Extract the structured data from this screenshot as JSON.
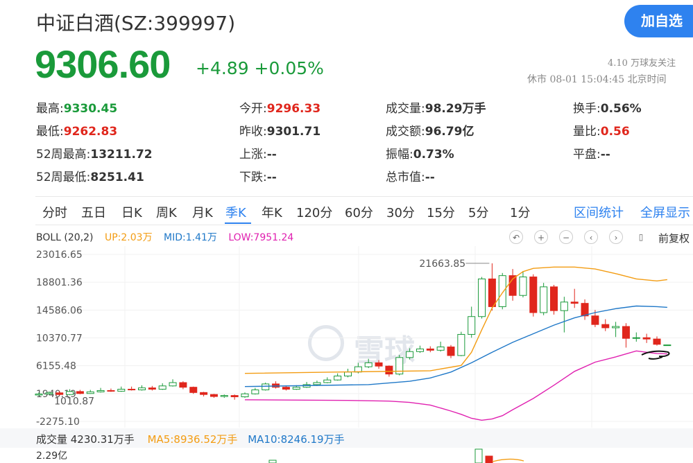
{
  "header": {
    "title": "中证白酒(SZ:399997)",
    "add_button": "加自选",
    "price": "9306.60",
    "change": "+4.89 +0.05%",
    "follow": "4.10 万球友关注",
    "status": "休市 08-01 15:04:45 北京时间"
  },
  "stats": [
    {
      "label": "最高:",
      "value": "9330.45",
      "tone": "down"
    },
    {
      "label": "今开:",
      "value": "9296.33",
      "tone": "up"
    },
    {
      "label": "成交量:",
      "value": "98.29万手",
      "tone": "neutral"
    },
    {
      "label": "换手:",
      "value": "0.56%",
      "tone": "neutral"
    },
    {
      "label": "最低:",
      "value": "9262.83",
      "tone": "up"
    },
    {
      "label": "昨收:",
      "value": "9301.71",
      "tone": "neutral"
    },
    {
      "label": "成交额:",
      "value": "96.79亿",
      "tone": "neutral"
    },
    {
      "label": "量比:",
      "value": "0.56",
      "tone": "up"
    },
    {
      "label": "52周最高:",
      "value": "13211.72",
      "tone": "neutral"
    },
    {
      "label": "上涨:",
      "value": "--",
      "tone": "neutral"
    },
    {
      "label": "振幅:",
      "value": "0.73%",
      "tone": "neutral"
    },
    {
      "label": "平盘:",
      "value": "--",
      "tone": "neutral"
    },
    {
      "label": "52周最低:",
      "value": "8251.41",
      "tone": "neutral"
    },
    {
      "label": "下跌:",
      "value": "--",
      "tone": "neutral"
    },
    {
      "label": "总市值:",
      "value": "--",
      "tone": "neutral"
    }
  ],
  "tabs": [
    "分时",
    "五日",
    "日K",
    "周K",
    "月K",
    "季K",
    "年K",
    "120分",
    "60分",
    "30分",
    "15分",
    "5分",
    "1分"
  ],
  "active_tab": "季K",
  "tab_actions": [
    "区间统计",
    "全屏显示"
  ],
  "indicator": {
    "name": "BOLL (20,2)",
    "up": "UP:2.03万",
    "mid": "MID:1.41万",
    "low": "LOW:7951.24",
    "up_color": "#f39c12",
    "mid_color": "#1f78c8",
    "low_color": "#e020b0"
  },
  "chart_controls": [
    "undo-icon",
    "zoom-in-icon",
    "zoom-out-icon",
    "scroll-left-icon",
    "scroll-right-icon",
    "candle-icon"
  ],
  "restore_label": "前复权",
  "watermark": "雪球",
  "volume": {
    "label": "成交量 4230.31万手",
    "ma5": "MA5:8936.52万手",
    "ma10": "MA10:8246.19万手",
    "max_label": "2.29亿",
    "ma5_color": "#f39c12",
    "ma10_color": "#1f78c8"
  },
  "colors": {
    "rise": "#e0261c",
    "fall": "#1a9a3a",
    "accent": "#2e82ef"
  },
  "chart_data": {
    "type": "candlestick",
    "y_ticks": [
      "23016.65",
      "18801.36",
      "14586.06",
      "10370.77",
      "6155.48",
      "1940.19",
      "-2275.10"
    ],
    "ylim": [
      -2275.1,
      23016.65
    ],
    "high_annotation": "21663.85",
    "low_annotation": "1010.87",
    "candles": [
      {
        "o": 1720,
        "c": 1880,
        "h": 2100,
        "l": 1600
      },
      {
        "o": 1880,
        "c": 2050,
        "h": 2300,
        "l": 1800
      },
      {
        "o": 2050,
        "c": 1800,
        "h": 2300,
        "l": 1700
      },
      {
        "o": 1800,
        "c": 2250,
        "h": 2600,
        "l": 1700
      },
      {
        "o": 2250,
        "c": 1950,
        "h": 2500,
        "l": 1850
      },
      {
        "o": 1950,
        "c": 2200,
        "h": 2500,
        "l": 1900
      },
      {
        "o": 2200,
        "c": 2400,
        "h": 2800,
        "l": 2100
      },
      {
        "o": 2400,
        "c": 2300,
        "h": 2700,
        "l": 2200
      },
      {
        "o": 2300,
        "c": 2600,
        "h": 3000,
        "l": 2200
      },
      {
        "o": 2600,
        "c": 2500,
        "h": 3000,
        "l": 2400
      },
      {
        "o": 2500,
        "c": 2800,
        "h": 3200,
        "l": 2400
      },
      {
        "o": 2800,
        "c": 2600,
        "h": 3100,
        "l": 2400
      },
      {
        "o": 2600,
        "c": 3100,
        "h": 3500,
        "l": 2500
      },
      {
        "o": 3100,
        "c": 3600,
        "h": 4100,
        "l": 3000
      },
      {
        "o": 3600,
        "c": 2900,
        "h": 3800,
        "l": 2600
      },
      {
        "o": 2900,
        "c": 2100,
        "h": 3000,
        "l": 1900
      },
      {
        "o": 2100,
        "c": 1800,
        "h": 2200,
        "l": 1500
      },
      {
        "o": 1800,
        "c": 1500,
        "h": 1900,
        "l": 1300
      },
      {
        "o": 1500,
        "c": 1650,
        "h": 1800,
        "l": 1300
      },
      {
        "o": 1650,
        "c": 1450,
        "h": 1800,
        "l": 1010.87
      },
      {
        "o": 1450,
        "c": 1900,
        "h": 2100,
        "l": 1300
      },
      {
        "o": 1900,
        "c": 2500,
        "h": 2800,
        "l": 1800
      },
      {
        "o": 2500,
        "c": 3400,
        "h": 3600,
        "l": 2400
      },
      {
        "o": 3400,
        "c": 2900,
        "h": 3800,
        "l": 2700
      },
      {
        "o": 2900,
        "c": 2600,
        "h": 3100,
        "l": 2400
      },
      {
        "o": 2600,
        "c": 2900,
        "h": 3200,
        "l": 2500
      },
      {
        "o": 2900,
        "c": 3300,
        "h": 3700,
        "l": 2800
      },
      {
        "o": 3300,
        "c": 3600,
        "h": 3900,
        "l": 3100
      },
      {
        "o": 3600,
        "c": 4000,
        "h": 4400,
        "l": 3500
      },
      {
        "o": 4000,
        "c": 4600,
        "h": 5000,
        "l": 3900
      },
      {
        "o": 4600,
        "c": 5200,
        "h": 5700,
        "l": 4400
      },
      {
        "o": 5200,
        "c": 6000,
        "h": 6600,
        "l": 5000
      },
      {
        "o": 6000,
        "c": 6600,
        "h": 7200,
        "l": 5800
      },
      {
        "o": 6600,
        "c": 6100,
        "h": 7000,
        "l": 5700
      },
      {
        "o": 6100,
        "c": 4900,
        "h": 6200,
        "l": 4500
      },
      {
        "o": 4900,
        "c": 7400,
        "h": 7800,
        "l": 4700
      },
      {
        "o": 7400,
        "c": 8300,
        "h": 8800,
        "l": 7100
      },
      {
        "o": 8300,
        "c": 8700,
        "h": 9200,
        "l": 8100
      },
      {
        "o": 8700,
        "c": 8500,
        "h": 9100,
        "l": 8200
      },
      {
        "o": 8500,
        "c": 9000,
        "h": 9800,
        "l": 8300
      },
      {
        "o": 9000,
        "c": 7700,
        "h": 9300,
        "l": 7300
      },
      {
        "o": 7700,
        "c": 10900,
        "h": 11300,
        "l": 7600
      },
      {
        "o": 10900,
        "c": 13600,
        "h": 15100,
        "l": 10400
      },
      {
        "o": 13600,
        "c": 19300,
        "h": 19600,
        "l": 13300
      },
      {
        "o": 19300,
        "c": 15100,
        "h": 21663.85,
        "l": 14500
      },
      {
        "o": 15100,
        "c": 19800,
        "h": 20200,
        "l": 14700
      },
      {
        "o": 19800,
        "c": 16800,
        "h": 20800,
        "l": 16000
      },
      {
        "o": 16800,
        "c": 19600,
        "h": 20500,
        "l": 16500
      },
      {
        "o": 19600,
        "c": 14200,
        "h": 20000,
        "l": 13600
      },
      {
        "o": 14200,
        "c": 18100,
        "h": 18700,
        "l": 13800
      },
      {
        "o": 18100,
        "c": 14500,
        "h": 18400,
        "l": 13900
      },
      {
        "o": 14500,
        "c": 15800,
        "h": 16600,
        "l": 11200
      },
      {
        "o": 15800,
        "c": 15600,
        "h": 17800,
        "l": 14900
      },
      {
        "o": 15600,
        "c": 13700,
        "h": 16200,
        "l": 13100
      },
      {
        "o": 13700,
        "c": 12400,
        "h": 14600,
        "l": 12000
      },
      {
        "o": 12400,
        "c": 11900,
        "h": 13200,
        "l": 11400
      },
      {
        "o": 11900,
        "c": 12100,
        "h": 12800,
        "l": 10500
      },
      {
        "o": 12100,
        "c": 10300,
        "h": 12600,
        "l": 8900
      },
      {
        "o": 10300,
        "c": 10400,
        "h": 11200,
        "l": 9800
      },
      {
        "o": 10400,
        "c": 10200,
        "h": 11000,
        "l": 9600
      },
      {
        "o": 10200,
        "c": 9400,
        "h": 10600,
        "l": 9200
      },
      {
        "o": 9300,
        "c": 9307,
        "h": 9330,
        "l": 9263
      }
    ],
    "boll_up": [
      [
        20,
        5000
      ],
      [
        38,
        5400
      ],
      [
        41,
        6200
      ],
      [
        42,
        8200
      ],
      [
        43,
        11600
      ],
      [
        44,
        14900
      ],
      [
        45,
        17200
      ],
      [
        46,
        19300
      ],
      [
        47,
        20400
      ],
      [
        48,
        20900
      ],
      [
        50,
        21100
      ],
      [
        52,
        21100
      ],
      [
        54,
        20800
      ],
      [
        56,
        20100
      ],
      [
        58,
        19300
      ],
      [
        60,
        19000
      ],
      [
        61,
        19200
      ]
    ],
    "boll_mid": [
      [
        20,
        3000
      ],
      [
        32,
        3300
      ],
      [
        36,
        3800
      ],
      [
        38,
        4300
      ],
      [
        40,
        5200
      ],
      [
        42,
        6600
      ],
      [
        44,
        8200
      ],
      [
        46,
        9700
      ],
      [
        48,
        11000
      ],
      [
        50,
        12300
      ],
      [
        52,
        13400
      ],
      [
        54,
        14200
      ],
      [
        56,
        14800
      ],
      [
        58,
        15200
      ],
      [
        60,
        15100
      ],
      [
        61,
        15000
      ]
    ],
    "boll_low": [
      [
        20,
        1000
      ],
      [
        30,
        900
      ],
      [
        34,
        800
      ],
      [
        36,
        600
      ],
      [
        38,
        200
      ],
      [
        40,
        -700
      ],
      [
        41,
        -1200
      ],
      [
        42,
        -1800
      ],
      [
        43,
        -2100
      ],
      [
        44,
        -1900
      ],
      [
        45,
        -1400
      ],
      [
        46,
        -500
      ],
      [
        48,
        1200
      ],
      [
        50,
        3200
      ],
      [
        52,
        5300
      ],
      [
        54,
        6700
      ],
      [
        56,
        7500
      ],
      [
        58,
        8400
      ],
      [
        60,
        8000
      ],
      [
        61,
        7951.24
      ]
    ]
  }
}
